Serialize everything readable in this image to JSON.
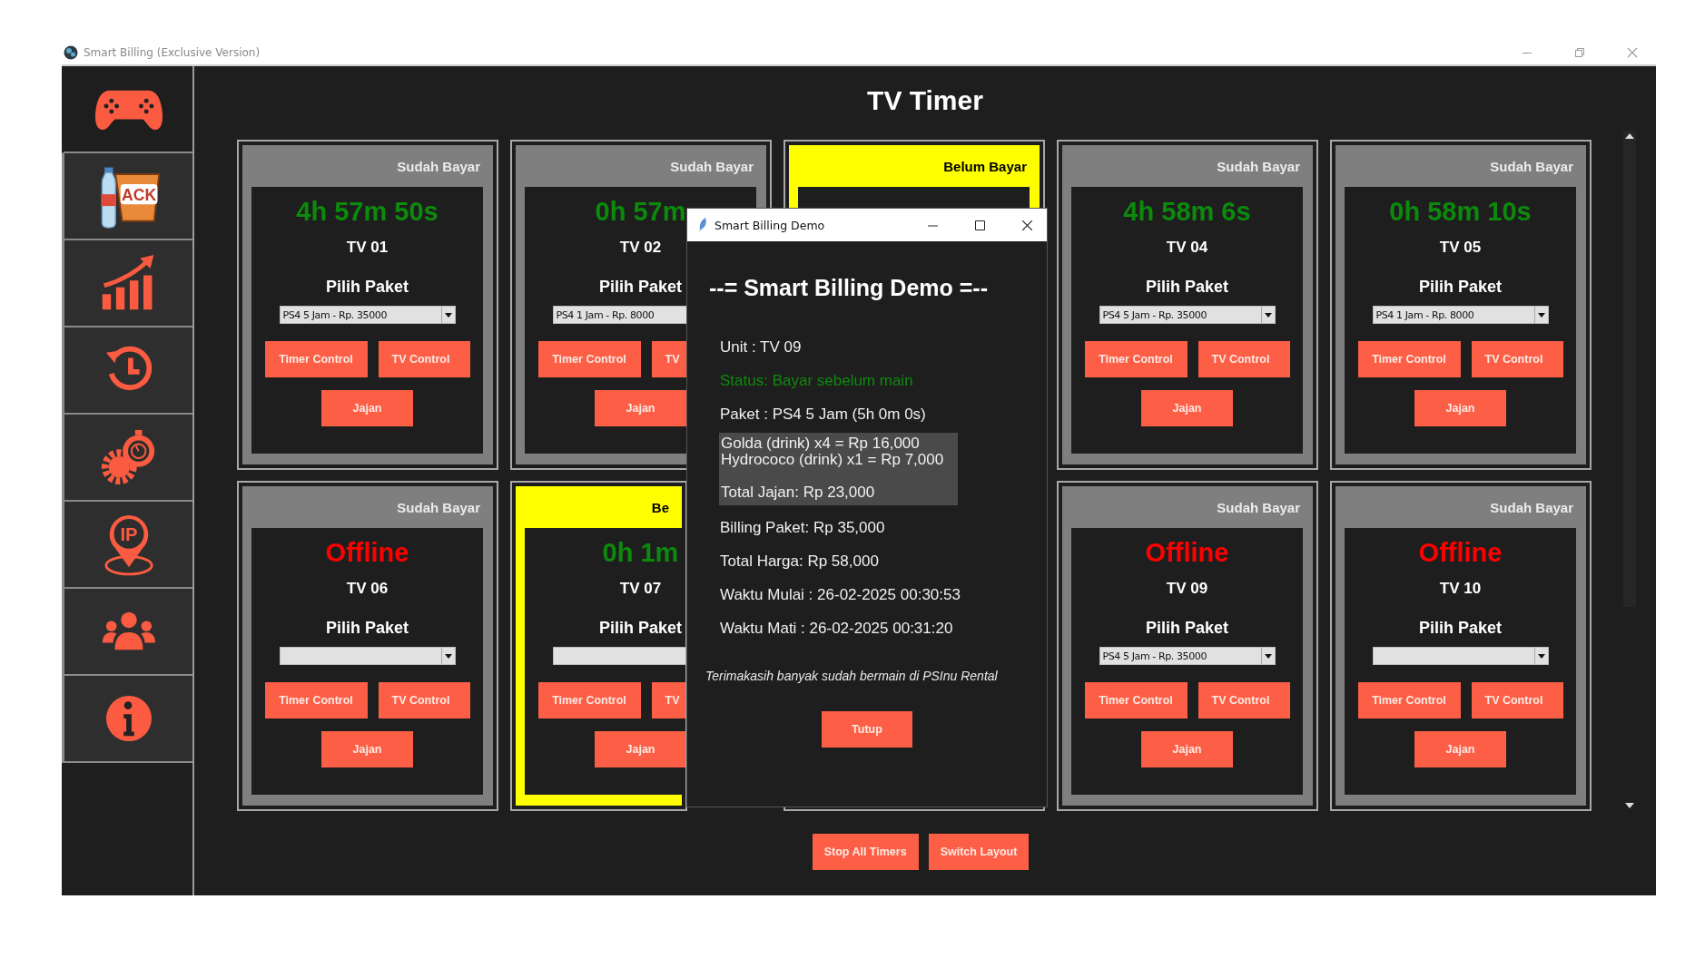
{
  "window": {
    "title": "Smart Billing (Exclusive Version)"
  },
  "sidebar": {
    "items": [
      {
        "kind": "gamepad",
        "selected": true
      },
      {
        "kind": "snack",
        "label": "ACK",
        "selected": false
      },
      {
        "kind": "chart",
        "selected": false
      },
      {
        "kind": "history",
        "selected": false
      },
      {
        "kind": "gear-timer",
        "selected": false
      },
      {
        "kind": "location",
        "label": "IP",
        "selected": false
      },
      {
        "kind": "users",
        "selected": false
      },
      {
        "kind": "info",
        "selected": false
      }
    ]
  },
  "page_title": "TV Timer",
  "cards": [
    {
      "status": "Sudah Bayar",
      "paid": true,
      "timer": "4h 57m 50s",
      "offline": false,
      "unit": "TV 01",
      "package_label": "Pilih Paket",
      "package": "PS4 5 Jam - Rp. 35000",
      "buttons": [
        "Timer Control",
        "TV Control",
        "Jajan"
      ]
    },
    {
      "status": "Sudah Bayar",
      "paid": true,
      "timer": "0h 57m",
      "offline": false,
      "unit": "TV 02",
      "package_label": "Pilih Paket",
      "package": "PS4 1 Jam - Rp. 8000",
      "buttons": [
        "Timer Control",
        "TV",
        "Jajan"
      ]
    },
    {
      "status": "Belum Bayar",
      "paid": false
    },
    {
      "status": "Sudah Bayar",
      "paid": true,
      "timer": "4h 58m 6s",
      "offline": false,
      "unit": "TV 04",
      "package_label": "Pilih Paket",
      "package": "PS4 5 Jam - Rp. 35000",
      "buttons": [
        "Timer Control",
        "TV Control",
        "Jajan"
      ]
    },
    {
      "status": "Sudah Bayar",
      "paid": true,
      "timer": "0h 58m 10s",
      "offline": false,
      "unit": "TV 05",
      "package_label": "Pilih Paket",
      "package": "PS4 1 Jam - Rp. 8000",
      "buttons": [
        "Timer Control",
        "TV Control",
        "Jajan"
      ]
    },
    {
      "status": "Sudah Bayar",
      "paid": true,
      "timer": "Offline",
      "offline": true,
      "unit": "TV 06",
      "package_label": "Pilih Paket",
      "buttons": [
        "Timer Control",
        "TV Control",
        "Jajan"
      ]
    },
    {
      "status": "Be",
      "paid": false,
      "cut": true,
      "timer": "0h 1m",
      "offline": false,
      "unit": "TV 07",
      "package_label": "Pilih Paket",
      "buttons": [
        "Timer Control",
        "TV",
        "Jajan"
      ]
    },
    {
      "status": "Sudah Bayar",
      "paid": true,
      "timer": "Offline",
      "offline": true,
      "unit": "TV 09",
      "package_label": "Pilih Paket",
      "package": "PS4 5 Jam - Rp. 35000",
      "buttons": [
        "Timer Control",
        "TV Control",
        "Jajan"
      ]
    },
    {
      "status": "Sudah Bayar",
      "paid": true,
      "timer": "Offline",
      "offline": true,
      "unit": "TV 10",
      "package_label": "Pilih Paket",
      "buttons": [
        "Timer Control",
        "TV Control",
        "Jajan"
      ]
    }
  ],
  "footer_buttons": [
    "Stop All Timers",
    "Switch Layout"
  ],
  "dialog": {
    "title": "Smart Billing Demo",
    "heading": "--= Smart Billing Demo =--",
    "unit": "Unit : TV 09",
    "status": "Status: Bayar sebelum main",
    "package": "Paket : PS4 5 Jam (5h 0m 0s)",
    "snacks": {
      "lines": [
        "Golda (drink) x4 = Rp 16,000",
        "Hydrococo (drink) x1 = Rp 7,000"
      ],
      "total": "Total Jajan: Rp 23,000"
    },
    "lines": [
      "Billing Paket: Rp 35,000",
      "Total Harga: Rp 58,000",
      "Waktu Mulai : 26-02-2025 00:30:53",
      "Waktu Mati : 26-02-2025 00:31:20"
    ],
    "thanks": "Terimakasih banyak sudah bermain di PSInu Rental",
    "close_button": "Tutup"
  }
}
